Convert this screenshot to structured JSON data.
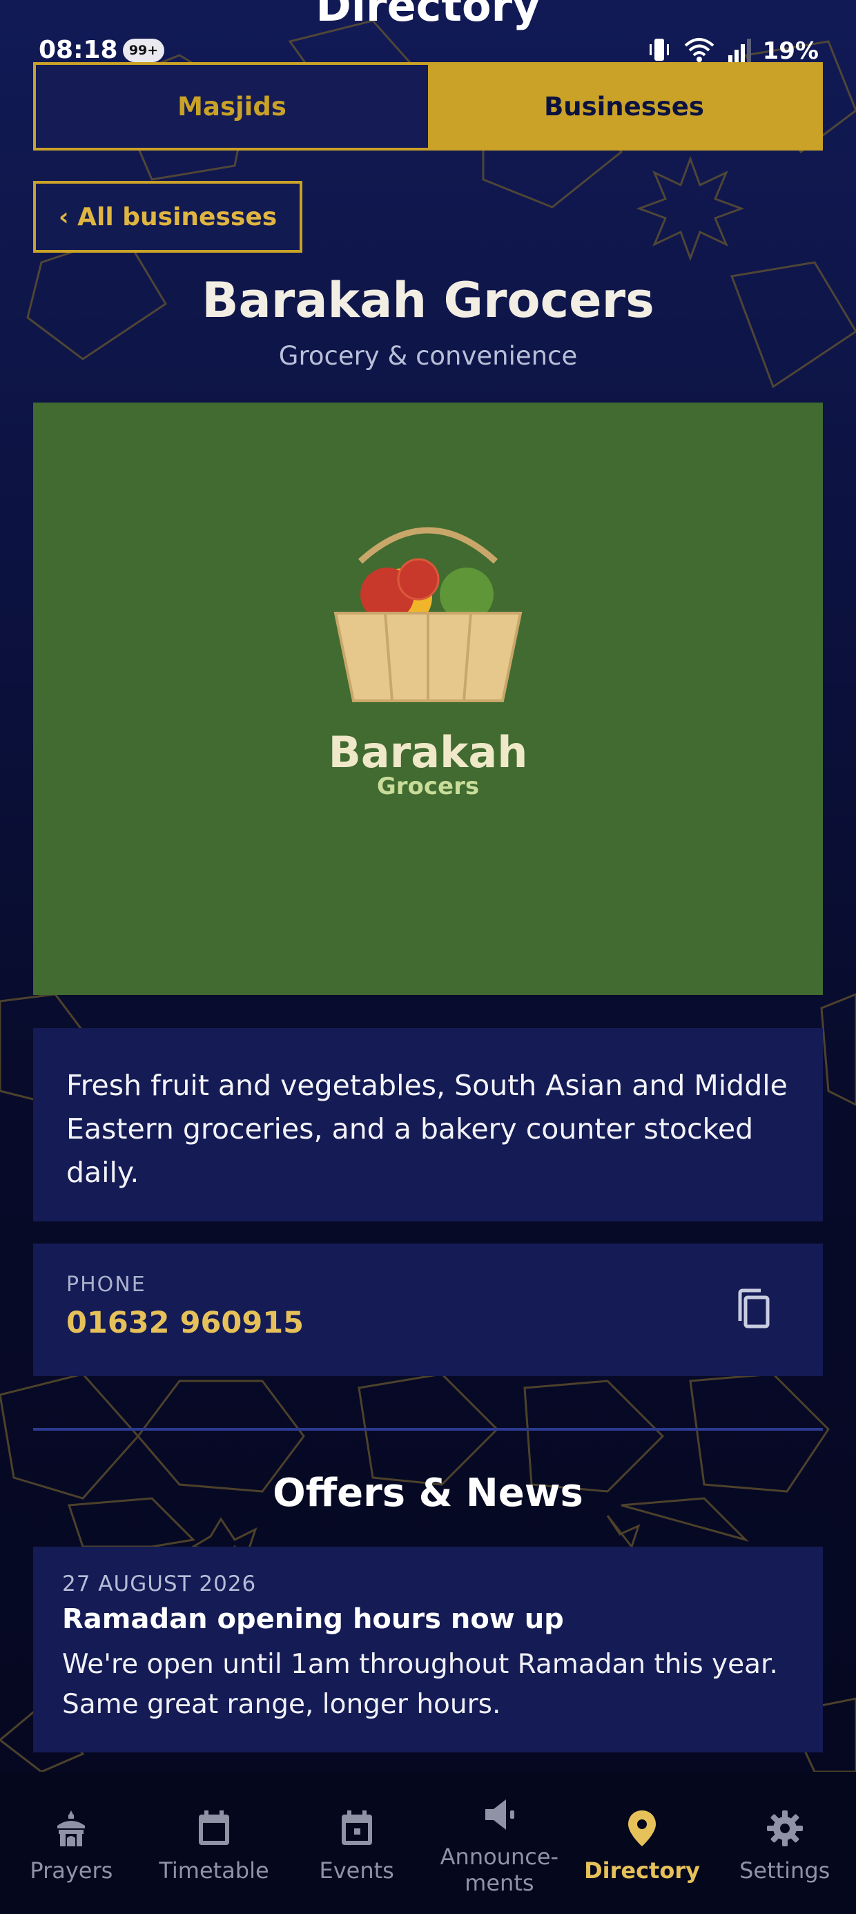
{
  "colors": {
    "accent_gold": "#c9a227",
    "background_navy": "#0c1240",
    "card_navy": "#141b55",
    "logo_green": "#416b30",
    "inactive_nav": "#8f93a6"
  },
  "page": {
    "title": "Directory"
  },
  "status_bar": {
    "time": "08:18",
    "badge": "99+",
    "battery": "19%"
  },
  "segments": [
    {
      "label": "Masjids",
      "active": false
    },
    {
      "label": "Businesses",
      "active": true
    }
  ],
  "back_button": {
    "label": "‹ All businesses"
  },
  "business": {
    "name": "Barakah Grocers",
    "category": "Grocery & convenience",
    "logo_title": "Barakah",
    "logo_subtitle": "Grocers",
    "description": "Fresh fruit and vegetables, South Asian and Middle Eastern groceries, and a bakery counter stocked daily.",
    "phone_label": "PHONE",
    "phone": "01632 960915"
  },
  "offers": {
    "title": "Offers & News",
    "items": [
      {
        "date": "27 AUGUST 2026",
        "title": "Ramadan opening hours now up",
        "body": "We're open until 1am throughout Ramadan this year. Same great range, longer hours."
      }
    ]
  },
  "nav": [
    {
      "label": "Prayers",
      "icon": "mosque-icon"
    },
    {
      "label": "Timetable",
      "icon": "calendar-icon"
    },
    {
      "label": "Events",
      "icon": "event-icon"
    },
    {
      "label": "Announce-\nments",
      "icon": "megaphone-icon"
    },
    {
      "label": "Directory",
      "icon": "location-pin-icon",
      "active": true
    },
    {
      "label": "Settings",
      "icon": "gear-icon"
    }
  ]
}
